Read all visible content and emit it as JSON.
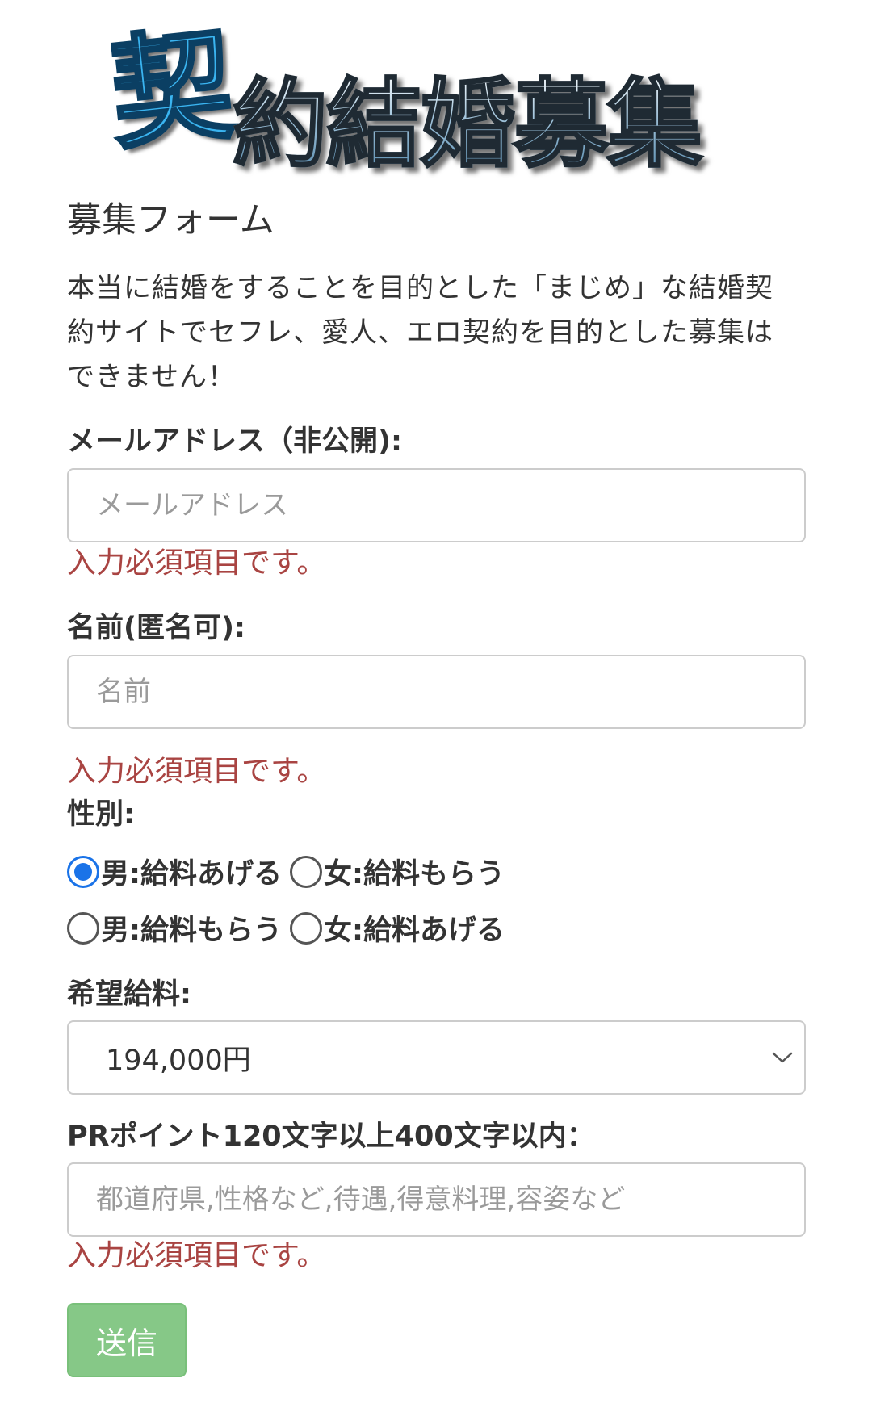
{
  "logo": {
    "first_char": "契",
    "rest": "約結婚募集"
  },
  "form": {
    "title": "募集フォーム",
    "intro": "本当に結婚をすることを目的とした「まじめ」な結婚契約サイトでセフレ、愛人、エロ契約を目的とした募集はできません！",
    "email": {
      "label": "メールアドレス（非公開):",
      "placeholder": "メールアドレス",
      "error": "入力必須項目です。"
    },
    "name": {
      "label": "名前(匿名可):",
      "placeholder": "名前",
      "error": "入力必須項目です。"
    },
    "gender": {
      "label": "性別:",
      "options": [
        {
          "label": "男:給料あげる",
          "checked": true
        },
        {
          "label": "女:給料もらう",
          "checked": false
        },
        {
          "label": "男:給料もらう",
          "checked": false
        },
        {
          "label": "女:給料あげる",
          "checked": false
        }
      ]
    },
    "salary": {
      "label": "希望給料:",
      "selected": "194,000円"
    },
    "pr": {
      "label": "PRポイント120文字以上400文字以内：",
      "placeholder": "都道府県,性格など,待遇,得意料理,容姿など",
      "error": "入力必須項目です。"
    },
    "submit_label": "送信"
  },
  "colors": {
    "error": "#a94442",
    "radio_checked": "#1a73e8",
    "submit_bg": "#86c887"
  }
}
